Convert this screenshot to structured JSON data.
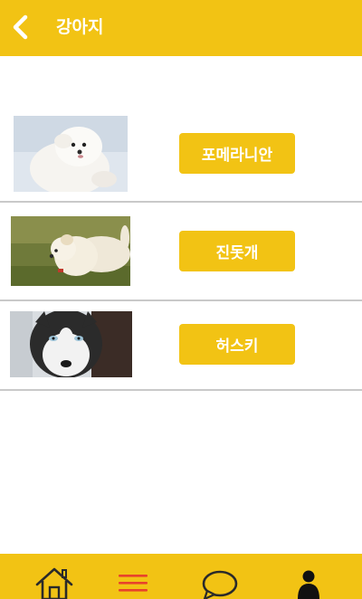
{
  "header": {
    "title": "강아지",
    "back_icon": "chevron-left-icon"
  },
  "breeds": [
    {
      "label": "포메라니안",
      "image": "pomeranian-photo"
    },
    {
      "label": "진돗개",
      "image": "jindo-photo"
    },
    {
      "label": "허스키",
      "image": "husky-photo"
    }
  ],
  "bottom_nav": {
    "items": [
      {
        "icon": "home-icon"
      },
      {
        "icon": "menu-icon"
      },
      {
        "icon": "chat-bubble-icon"
      },
      {
        "icon": "person-icon"
      }
    ]
  },
  "colors": {
    "accent": "#f2c314",
    "menu_icon": "#e8432b",
    "text_on_accent": "#ffffff",
    "divider": "#c9c9c9"
  }
}
